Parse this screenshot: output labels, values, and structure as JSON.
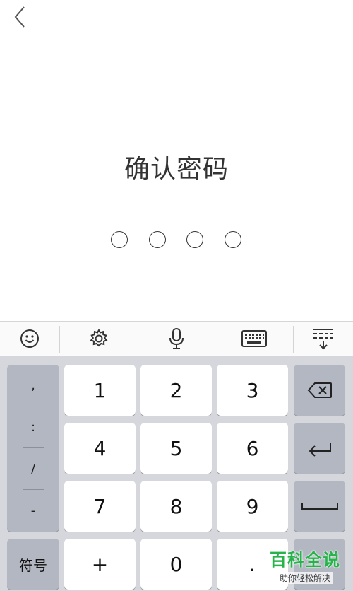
{
  "header": {
    "back_icon": "chevron-left-icon"
  },
  "title": "确认密码",
  "pin": {
    "length": 4,
    "entered": 0
  },
  "toolbar": {
    "items": [
      {
        "name": "emoji-icon"
      },
      {
        "name": "gear-icon"
      },
      {
        "name": "microphone-icon"
      },
      {
        "name": "keyboard-icon"
      },
      {
        "name": "collapse-keyboard-icon"
      }
    ]
  },
  "keyboard": {
    "symbols": [
      ",",
      ":",
      "/",
      "-"
    ],
    "digits": {
      "k1": "1",
      "k2": "2",
      "k3": "3",
      "k4": "4",
      "k5": "5",
      "k6": "6",
      "k7": "7",
      "k8": "8",
      "k9": "9",
      "k0": "0"
    },
    "plus": "+",
    "dot": ".",
    "fuhao": "符号",
    "backspace_icon": "backspace-icon",
    "enter_icon": "enter-icon",
    "space_icon": "space-icon"
  },
  "watermark": {
    "main": "百科全说",
    "sub": "助你轻松解决"
  }
}
